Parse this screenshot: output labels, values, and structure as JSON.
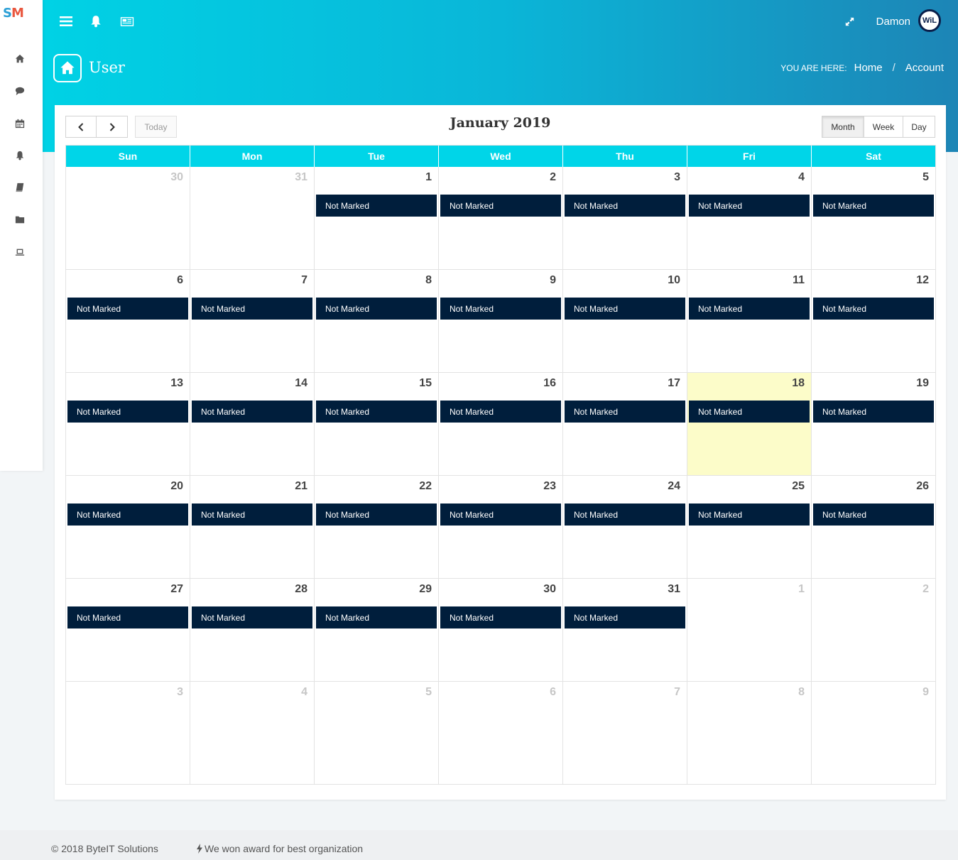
{
  "logo": {
    "s": "S",
    "m": "M"
  },
  "header": {
    "username": "Damon",
    "avatar_text": "WiL",
    "page_title": "User",
    "breadcrumb_label": "YOU ARE HERE:",
    "breadcrumb_home": "Home",
    "breadcrumb_sep": "/",
    "breadcrumb_current": "Account"
  },
  "calendar": {
    "title": "January 2019",
    "today_label": "Today",
    "views": [
      "Month",
      "Week",
      "Day"
    ],
    "active_view": "Month",
    "dow": [
      "Sun",
      "Mon",
      "Tue",
      "Wed",
      "Thu",
      "Fri",
      "Sat"
    ],
    "event_label": "Not Marked",
    "today_day": 18,
    "weeks": [
      [
        {
          "d": "30",
          "o": true
        },
        {
          "d": "31",
          "o": true
        },
        {
          "d": "1",
          "e": true
        },
        {
          "d": "2",
          "e": true
        },
        {
          "d": "3",
          "e": true
        },
        {
          "d": "4",
          "e": true
        },
        {
          "d": "5",
          "e": true
        }
      ],
      [
        {
          "d": "6",
          "e": true
        },
        {
          "d": "7",
          "e": true
        },
        {
          "d": "8",
          "e": true
        },
        {
          "d": "9",
          "e": true
        },
        {
          "d": "10",
          "e": true
        },
        {
          "d": "11",
          "e": true
        },
        {
          "d": "12",
          "e": true
        }
      ],
      [
        {
          "d": "13",
          "e": true
        },
        {
          "d": "14",
          "e": true
        },
        {
          "d": "15",
          "e": true
        },
        {
          "d": "16",
          "e": true
        },
        {
          "d": "17",
          "e": true
        },
        {
          "d": "18",
          "e": true
        },
        {
          "d": "19",
          "e": true
        }
      ],
      [
        {
          "d": "20",
          "e": true
        },
        {
          "d": "21",
          "e": true
        },
        {
          "d": "22",
          "e": true
        },
        {
          "d": "23",
          "e": true
        },
        {
          "d": "24",
          "e": true
        },
        {
          "d": "25",
          "e": true
        },
        {
          "d": "26",
          "e": true
        }
      ],
      [
        {
          "d": "27",
          "e": true
        },
        {
          "d": "28",
          "e": true
        },
        {
          "d": "29",
          "e": true
        },
        {
          "d": "30",
          "e": true
        },
        {
          "d": "31",
          "e": true
        },
        {
          "d": "1",
          "o": true
        },
        {
          "d": "2",
          "o": true
        }
      ],
      [
        {
          "d": "3",
          "o": true
        },
        {
          "d": "4",
          "o": true
        },
        {
          "d": "5",
          "o": true
        },
        {
          "d": "6",
          "o": true
        },
        {
          "d": "7",
          "o": true
        },
        {
          "d": "8",
          "o": true
        },
        {
          "d": "9",
          "o": true
        }
      ]
    ]
  },
  "footer": {
    "copyright": "© 2018 ByteIT Solutions",
    "award": "We won award for best organization"
  },
  "icons": {
    "sidebar": [
      "home-icon",
      "comment-icon",
      "calendar-icon",
      "bell-icon",
      "book-icon",
      "folder-icon",
      "laptop-icon"
    ],
    "topbar": [
      "menu-icon",
      "bell-icon",
      "newspaper-icon",
      "expand-icon"
    ]
  },
  "colors": {
    "header_start": "#00d2e5",
    "header_end": "#1d85b6",
    "dow_header": "#00d5e8",
    "event_bg": "#001e3c",
    "today_bg": "#fcfcc9"
  }
}
